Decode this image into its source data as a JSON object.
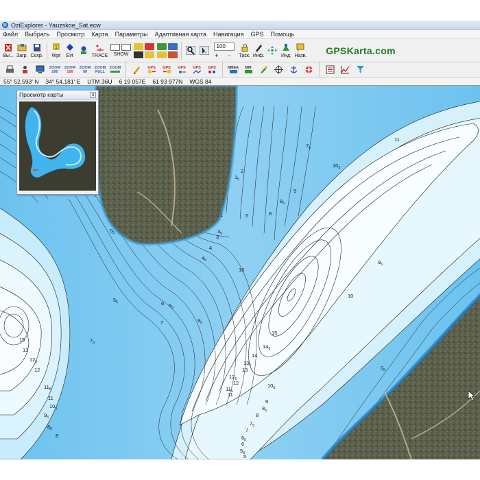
{
  "window": {
    "title": "OziExplorer - Yauzskoe_Sat.ecw"
  },
  "menu": [
    "Файл",
    "Выбрать",
    "Просмотр",
    "Карта",
    "Параметры",
    "Адаптивная карта",
    "Навигация",
    "GPS",
    "Помощь"
  ],
  "toolbar1": {
    "exit_label": "Вы...",
    "load_label": "Загр.",
    "save_label": "Сохр.",
    "wpt_label": "Wpt",
    "evt_label": "Evt",
    "trace_label": "TRACE",
    "show_label": "SHOW",
    "zoom_value": "100",
    "zoom_pm": "+ -",
    "track_label": "Таск.",
    "info_label": "Инф.",
    "ind_label": "Инд.",
    "names_label": "Назв.",
    "brand": "GPSKarta.com"
  },
  "toolbar2": {
    "zoom_buttons": [
      {
        "top": "ZOOM",
        "bottom": "200"
      },
      {
        "top": "ZOOM",
        "bottom": "100"
      },
      {
        "top": "ZOOM",
        "bottom": "50"
      },
      {
        "top": "ZOOM",
        "bottom": "FULL"
      },
      {
        "top": "ZOOM",
        "bottom": ""
      }
    ],
    "gps_label": "GPS",
    "nmea_label": "NMEA",
    "mm_label": "MM"
  },
  "status": {
    "lat": "55° 52,593' N",
    "lon": "34° 54,181' E",
    "utm": "UTM  36U",
    "easting": "6 19 057E",
    "northing": "61 93 977N",
    "datum": "WGS 84"
  },
  "preview": {
    "title": "Просмотр карты",
    "close": "x"
  },
  "colors": {
    "water_deep": "#ffffff",
    "water_mid": "#a6dcf6",
    "water_shallow": "#1e8ed8",
    "land": "#595f49",
    "brand": "#1f7a1f"
  },
  "depth_labels": [
    {
      "text": "11"
    },
    {
      "text": "10",
      "sub": "5"
    },
    {
      "text": "9"
    },
    {
      "text": "8",
      "sub": "5"
    },
    {
      "text": "8"
    },
    {
      "text": "7",
      "sub": "5"
    },
    {
      "text": "5"
    },
    {
      "text": "10"
    },
    {
      "text": "9",
      "sub": "5"
    },
    {
      "text": "10"
    },
    {
      "text": "15"
    },
    {
      "text": "14",
      "sub": "5"
    },
    {
      "text": "14"
    },
    {
      "text": "13",
      "sub": "5"
    },
    {
      "text": "13"
    },
    {
      "text": "12",
      "sub": "5"
    },
    {
      "text": "12"
    },
    {
      "text": "11",
      "sub": "5"
    },
    {
      "text": "11"
    },
    {
      "text": "10",
      "sub": "5"
    },
    {
      "text": "9"
    },
    {
      "text": "8",
      "sub": "5"
    },
    {
      "text": "8"
    },
    {
      "text": "7",
      "sub": "5"
    },
    {
      "text": "7"
    },
    {
      "text": "6",
      "sub": "5"
    },
    {
      "text": "6"
    },
    {
      "text": "5",
      "sub": "5"
    },
    {
      "text": "5"
    },
    {
      "text": "4",
      "sub": "5"
    },
    {
      "text": "4"
    },
    {
      "text": "9",
      "sub": "5"
    },
    {
      "text": "7"
    },
    {
      "text": "6"
    },
    {
      "text": "6",
      "sub": "5"
    },
    {
      "text": "5",
      "sub": "5"
    },
    {
      "text": "4"
    },
    {
      "text": "4",
      "sub": "5"
    },
    {
      "text": "3"
    },
    {
      "text": "3",
      "sub": "5"
    },
    {
      "text": "2"
    },
    {
      "text": "1",
      "sub": "5"
    },
    {
      "text": "1"
    },
    {
      "text": "0",
      "sub": "5"
    },
    {
      "text": "15",
      "sub": ""
    },
    {
      "text": "13"
    },
    {
      "text": "12",
      "sub": "5"
    },
    {
      "text": "12"
    },
    {
      "text": "11",
      "sub": "5"
    },
    {
      "text": "11"
    },
    {
      "text": "10",
      "sub": "5"
    },
    {
      "text": "9",
      "sub": "5"
    },
    {
      "text": "8",
      "sub": "5"
    },
    {
      "text": "8"
    },
    {
      "text": "7",
      "sub": "5"
    },
    {
      "text": "0",
      "sub": "5"
    }
  ]
}
